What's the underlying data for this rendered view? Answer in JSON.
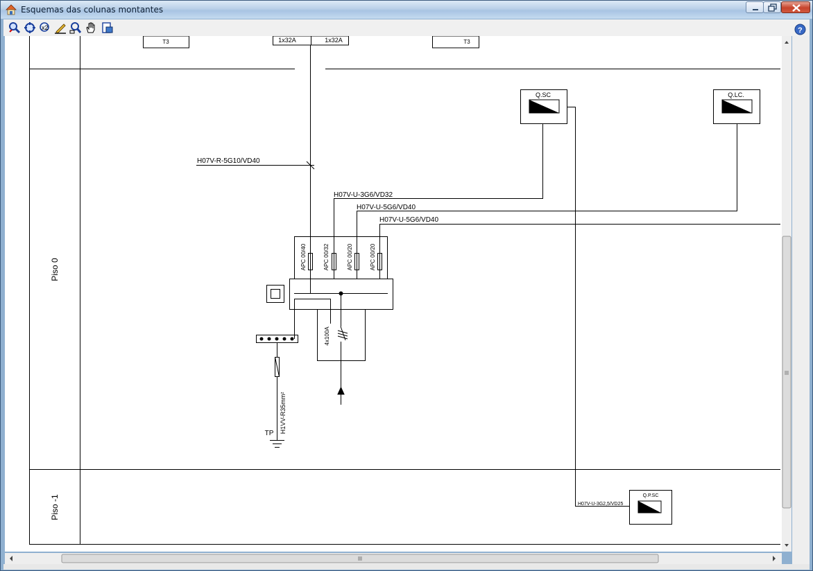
{
  "window": {
    "title": "Esquemas das colunas montantes"
  },
  "toolbar": {
    "tools": [
      "zoom-icon",
      "zoom-extents-icon",
      "zoom-previous-icon",
      "edit-icon",
      "zoom-window-icon",
      "pan-hand-icon",
      "print-preview-icon"
    ],
    "help_icon": "help-icon"
  },
  "diagram": {
    "floors": {
      "piso0": "Piso 0",
      "piso_minus1": "Piso -1"
    },
    "top_boxes": {
      "left_t3": "T3",
      "mid_1x32a_a": "1x32A",
      "mid_1x32a_b": "1x32A",
      "right_t3": "T3"
    },
    "panels": {
      "qsc": "Q.SC",
      "qlc": "Q.LC.",
      "qpsc": "Q.P.SC"
    },
    "cables": {
      "h07vr": "H07V-R-5G10/VD40",
      "h07vu_3g6": "H07V-U-3G6/VD32",
      "h07vu_5g6_a": "H07V-U-5G6/VD40",
      "h07vu_5g6_b": "H07V-U-5G6/VD40",
      "h07vu_3g25": "H07V-U-3G2,5/VD25",
      "h1vv": "H1VV-R35mm²"
    },
    "breakers": {
      "b1": "APC 00/40",
      "b2": "APC 00/32",
      "b3": "APC 00/20",
      "b4": "APC 00/20",
      "main": "4x100A"
    },
    "earth": {
      "tp": "TP"
    }
  }
}
